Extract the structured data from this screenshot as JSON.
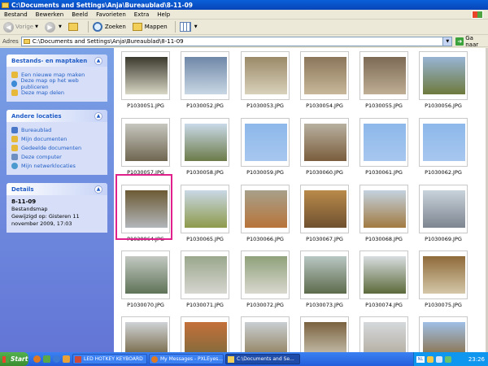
{
  "window": {
    "title": "C:\\Documents and Settings\\Anja\\Bureaublad\\8-11-09"
  },
  "menu": [
    "Bestand",
    "Bewerken",
    "Beeld",
    "Favorieten",
    "Extra",
    "Help"
  ],
  "toolbar": {
    "back_label": "Vorige",
    "search_label": "Zoeken",
    "folders_label": "Mappen"
  },
  "address": {
    "label": "Adres",
    "value": "C:\\Documents and Settings\\Anja\\Bureaublad\\8-11-09",
    "go_label": "Ga naar"
  },
  "sidebar": {
    "file_tasks": {
      "title": "Bestands- en maptaken",
      "items": [
        {
          "label": "Een nieuwe map maken",
          "icon": "new-folder-icon",
          "color": "#e6b93a"
        },
        {
          "label": "Deze map op het web publiceren",
          "icon": "publish-web-icon",
          "color": "#3d8ad6"
        },
        {
          "label": "Deze map delen",
          "icon": "share-folder-icon",
          "color": "#e6b93a"
        }
      ]
    },
    "other_places": {
      "title": "Andere locaties",
      "items": [
        {
          "label": "Bureaublad",
          "icon": "desktop-icon",
          "color": "#4a78c9"
        },
        {
          "label": "Mijn documenten",
          "icon": "my-documents-icon",
          "color": "#e6b93a"
        },
        {
          "label": "Gedeelde documenten",
          "icon": "shared-documents-icon",
          "color": "#e6b93a"
        },
        {
          "label": "Deze computer",
          "icon": "my-computer-icon",
          "color": "#6d8fc2"
        },
        {
          "label": "Mijn netwerklocaties",
          "icon": "network-places-icon",
          "color": "#4a9ad0"
        }
      ]
    },
    "details": {
      "title": "Details",
      "name": "8-11-09",
      "type": "Bestandsmap",
      "modified": "Gewijzigd op: Gisteren 11 november 2009, 17:03"
    }
  },
  "files": [
    {
      "name": "P1030051.JPG",
      "colors": [
        "#3b3a2e",
        "#d8d6c4"
      ]
    },
    {
      "name": "P1030052.JPG",
      "colors": [
        "#6f88a8",
        "#c9d7e4"
      ]
    },
    {
      "name": "P1030053.JPG",
      "colors": [
        "#9a8a68",
        "#d9d1bb"
      ]
    },
    {
      "name": "P1030054.JPG",
      "colors": [
        "#8b765a",
        "#c8b89a"
      ]
    },
    {
      "name": "P1030055.JPG",
      "colors": [
        "#7c6a55",
        "#bfae94"
      ]
    },
    {
      "name": "P1030056.JPG",
      "colors": [
        "#98b4d4",
        "#6e7a3c"
      ]
    },
    {
      "name": "P1030057.JPG",
      "colors": [
        "#c7c7c0",
        "#6f6650"
      ]
    },
    {
      "name": "P1030058.JPG",
      "colors": [
        "#c9d9e8",
        "#6c7b48"
      ]
    },
    {
      "name": "P1030059.JPG",
      "colors": [
        "#8db8ea",
        "#a7c7ef"
      ]
    },
    {
      "name": "P1030060.JPG",
      "colors": [
        "#b8b0a0",
        "#7a5d3c"
      ]
    },
    {
      "name": "P1030061.JPG",
      "colors": [
        "#8db8ea",
        "#a7c7ef"
      ]
    },
    {
      "name": "P1030062.JPG",
      "colors": [
        "#8db8ea",
        "#a7c7ef"
      ]
    },
    {
      "name": "P1030064.JPG",
      "colors": [
        "#6c5a34",
        "#b2b6ba"
      ]
    },
    {
      "name": "P1030065.JPG",
      "colors": [
        "#c9d8e6",
        "#8e9a4a"
      ]
    },
    {
      "name": "P1030066.JPG",
      "colors": [
        "#a7a08a",
        "#b8743a"
      ]
    },
    {
      "name": "P1030067.JPG",
      "colors": [
        "#b98a4a",
        "#6f5130"
      ]
    },
    {
      "name": "P1030068.JPG",
      "colors": [
        "#c3d2e0",
        "#a27a40"
      ]
    },
    {
      "name": "P1030069.JPG",
      "colors": [
        "#c9d3db",
        "#7d8590"
      ]
    },
    {
      "name": "P1030070.JPG",
      "colors": [
        "#c3c9c2",
        "#5f7358"
      ]
    },
    {
      "name": "P1030071.JPG",
      "colors": [
        "#9aa78c",
        "#d6d6d0"
      ]
    },
    {
      "name": "P1030072.JPG",
      "colors": [
        "#8fa17a",
        "#d9d8cf"
      ]
    },
    {
      "name": "P1030073.JPG",
      "colors": [
        "#b9c7c4",
        "#5d6b4c"
      ]
    },
    {
      "name": "P1030074.JPG",
      "colors": [
        "#d8dde0",
        "#5b6a3a"
      ]
    },
    {
      "name": "P1030075.JPG",
      "colors": [
        "#8f6a3a",
        "#d4c7a8"
      ]
    },
    {
      "name": "",
      "colors": [
        "#cfd3d6",
        "#6b5a34"
      ]
    },
    {
      "name": "",
      "colors": [
        "#c4703a",
        "#7a6a3c"
      ]
    },
    {
      "name": "",
      "colors": [
        "#c9ced2",
        "#8c7a52"
      ]
    },
    {
      "name": "",
      "colors": [
        "#7a6240",
        "#cfcab8"
      ]
    },
    {
      "name": "",
      "colors": [
        "#d5d9dc",
        "#b0a89a"
      ]
    },
    {
      "name": "",
      "colors": [
        "#9fbfe6",
        "#8a6a3a"
      ]
    }
  ],
  "selected_file": "P1030064.JPG",
  "taskbar": {
    "start_label": "Start",
    "buttons": [
      {
        "label": "LED HOTKEY KEYBOARD",
        "icon": "keyboard-icon",
        "color": "#d04a3a"
      },
      {
        "label": "My Messages - PXLEyes...",
        "icon": "firefox-icon",
        "color": "#e07a22"
      },
      {
        "label": "C:\\Documents and Se...",
        "icon": "folder-icon",
        "color": "#f2cf59"
      }
    ],
    "tray_lang": "NL",
    "clock": "23:26"
  }
}
